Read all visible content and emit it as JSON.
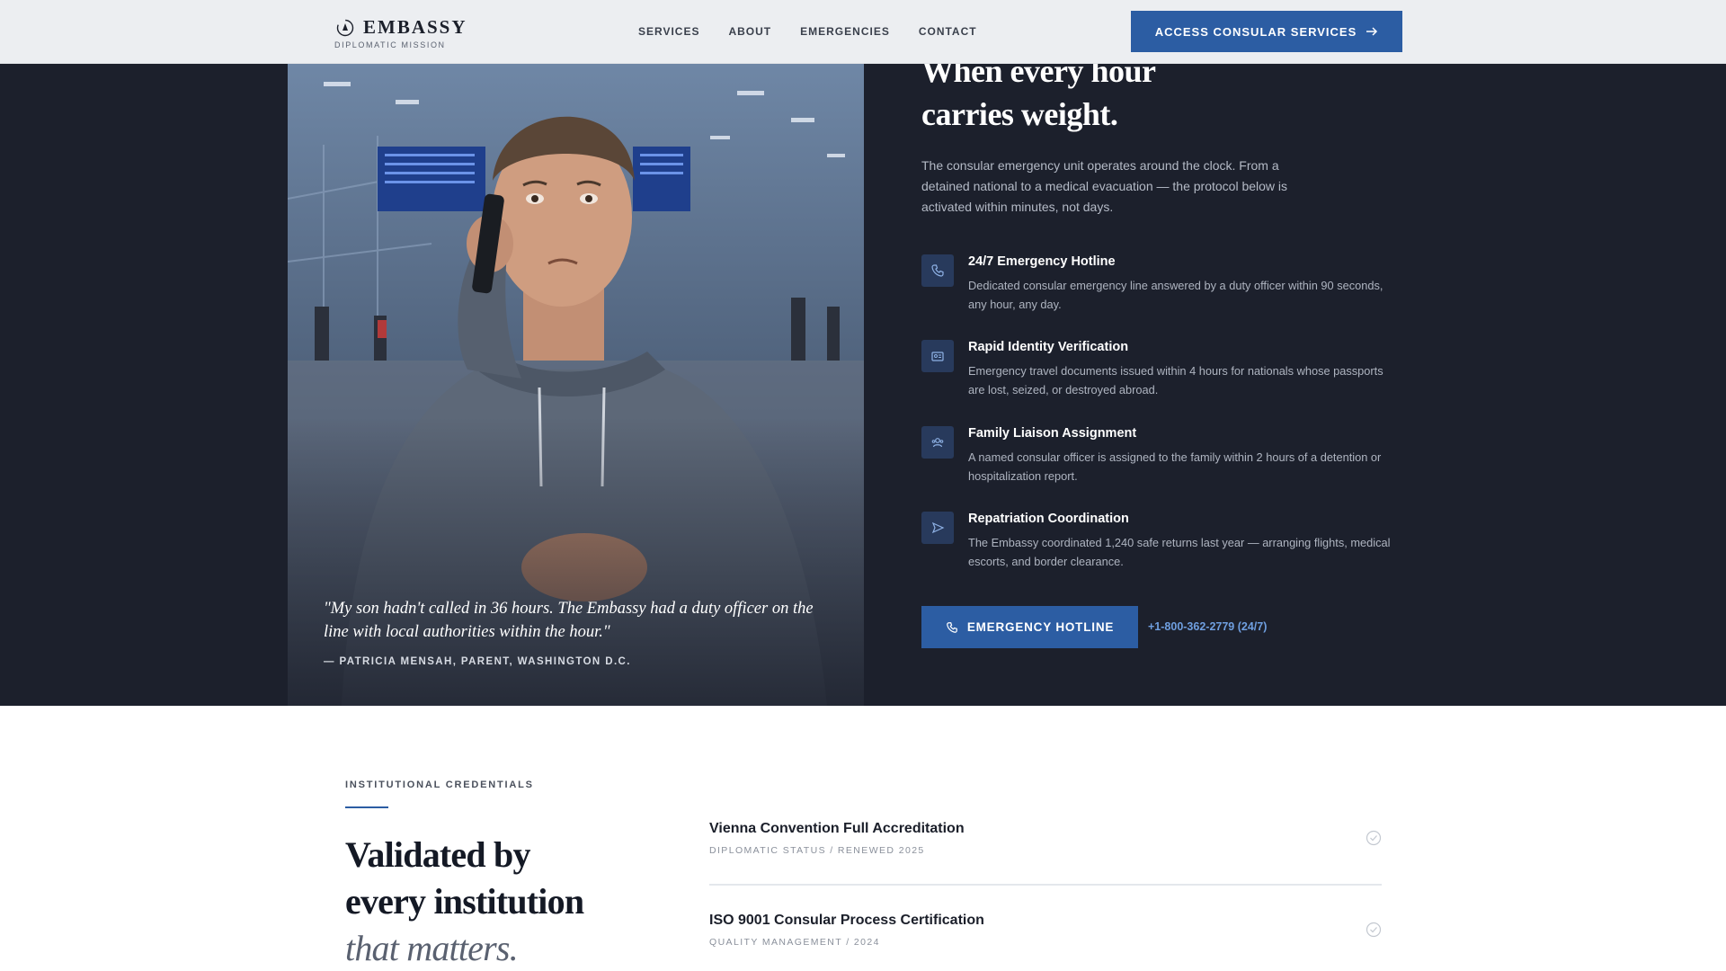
{
  "header": {
    "brand": "EMBASSY",
    "brand_sub": "DIPLOMATIC MISSION",
    "nav": [
      "SERVICES",
      "ABOUT",
      "EMERGENCIES",
      "CONTACT"
    ],
    "cta": "ACCESS CONSULAR SERVICES",
    "cta_icon": "arrow-right-icon"
  },
  "hero": {
    "headline_1": "When every hour",
    "headline_2": "carries weight.",
    "intro": "The consular emergency unit operates around the clock. From a detained national to a medical evacuation — the protocol below is activated within minutes, not days.",
    "quote": "\"My son hadn't called in 36 hours. The Embassy had a duty officer on the line with local authorities within the hour.\"",
    "quote_author": "— PATRICIA MENSAH, PARENT, WASHINGTON D.C.",
    "features": [
      {
        "icon": "phone-icon",
        "title": "24/7 Emergency Hotline",
        "desc": "Dedicated consular emergency line answered by a duty officer within 90 seconds, any hour, any day."
      },
      {
        "icon": "id-card-icon",
        "title": "Rapid Identity Verification",
        "desc": "Emergency travel documents issued within 4 hours for nationals whose passports are lost, seized, or destroyed abroad."
      },
      {
        "icon": "people-icon",
        "title": "Family Liaison Assignment",
        "desc": "A named consular officer is assigned to the family within 2 hours of a detention or hospitalization report."
      },
      {
        "icon": "send-icon",
        "title": "Repatriation Coordination",
        "desc": "The Embassy coordinated 1,240 safe returns last year — arranging flights, medical escorts, and border clearance."
      }
    ],
    "hotline_button": "EMERGENCY HOTLINE",
    "hotline_number": "+1-800-362-2779 (24/7)"
  },
  "credentials": {
    "eyebrow": "INSTITUTIONAL CREDENTIALS",
    "title_1": "Validated by",
    "title_2": "every institution",
    "title_3": "that matters.",
    "items": [
      {
        "title": "Vienna Convention Full Accreditation",
        "meta": "DIPLOMATIC STATUS / RENEWED 2025"
      },
      {
        "title": "ISO 9001 Consular Process Certification",
        "meta": "QUALITY MANAGEMENT / 2024"
      }
    ]
  },
  "colors": {
    "accent": "#2c5da3",
    "dark_bg": "#1c202c",
    "link": "#6f9fe0"
  }
}
